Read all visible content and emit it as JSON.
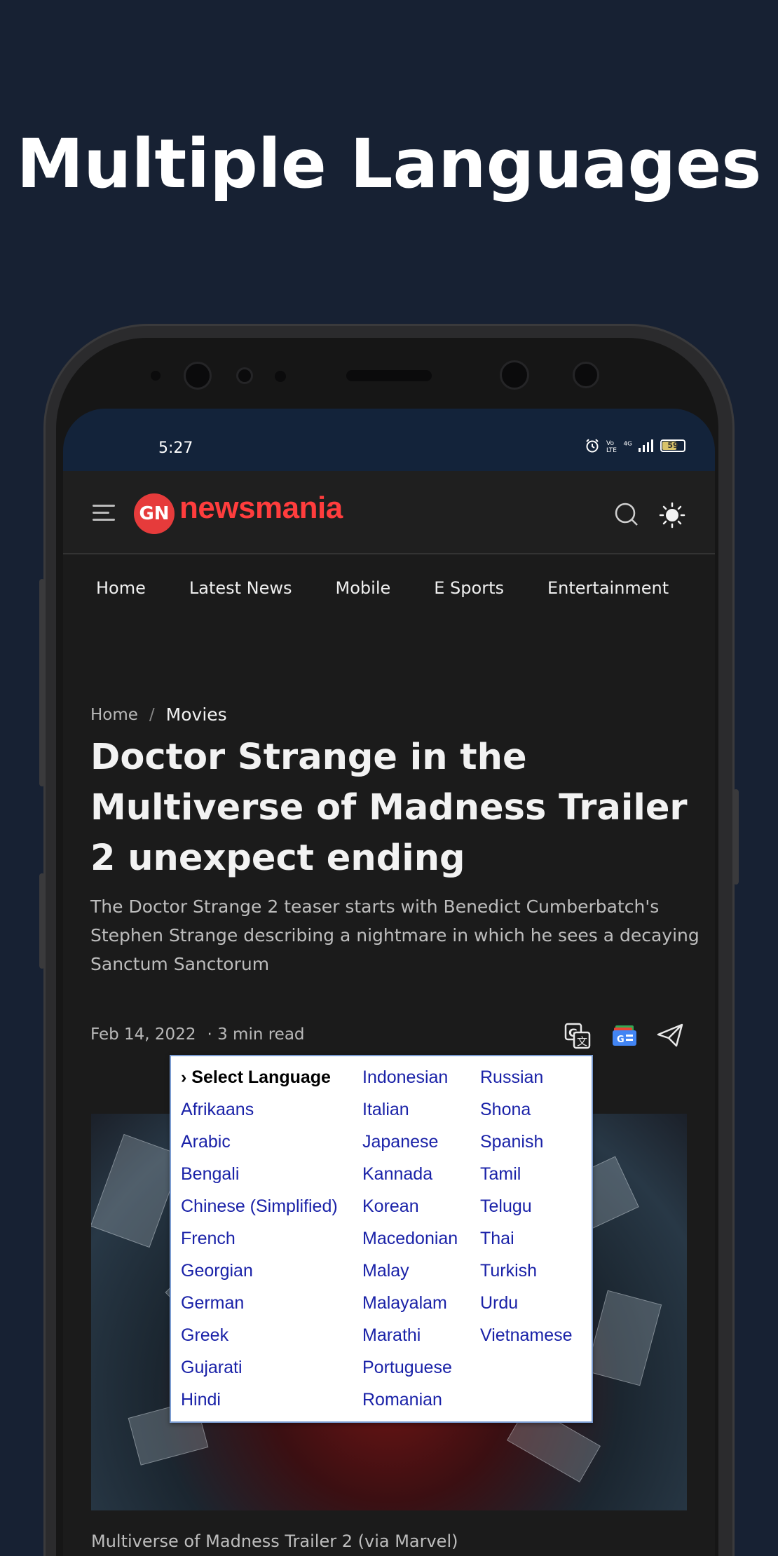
{
  "promo": {
    "title": "Multiple Languages"
  },
  "status_bar": {
    "time": "5:27",
    "signal_text": "⁴ᴳ",
    "battery": "59"
  },
  "header": {
    "logo_badge": "GN",
    "logo_text": "newsmania"
  },
  "nav": {
    "items": [
      {
        "label": "Home"
      },
      {
        "label": "Latest News"
      },
      {
        "label": "Mobile"
      },
      {
        "label": "E Sports"
      },
      {
        "label": "Entertainment"
      }
    ]
  },
  "breadcrumb": {
    "home": "Home",
    "separator": "/",
    "current": "Movies"
  },
  "article": {
    "title": "Doctor Strange in the Multiverse of Madness Trailer 2 unexpect ending",
    "subtitle": "The Doctor Strange 2 teaser starts with Benedict Cumberbatch's Stephen Strange describing a nightmare in which he sees a decaying Sanctum Sanctorum",
    "date": "Feb 14, 2022",
    "read_time": "· 3 min read",
    "caption": "Multiverse of Madness Trailer 2 (via Marvel)"
  },
  "language_menu": {
    "columns": [
      [
        "› Select Language",
        "Afrikaans",
        "Arabic",
        "Bengali",
        "Chinese (Simplified)",
        "French",
        "Georgian",
        "German",
        "Greek",
        "Gujarati",
        "Hindi"
      ],
      [
        "Indonesian",
        "Italian",
        "Japanese",
        "Kannada",
        "Korean",
        "Macedonian",
        "Malay",
        "Malayalam",
        "Marathi",
        "Portuguese",
        "Romanian"
      ],
      [
        "Russian",
        "Shona",
        "Spanish",
        "Tamil",
        "Telugu",
        "Thai",
        "Turkish",
        "Urdu",
        "Vietnamese"
      ]
    ]
  },
  "colors": {
    "background": "#172133",
    "status_bar": "#13233a",
    "brand_red": "#ff3d3d",
    "link_blue": "#1a22a8"
  }
}
